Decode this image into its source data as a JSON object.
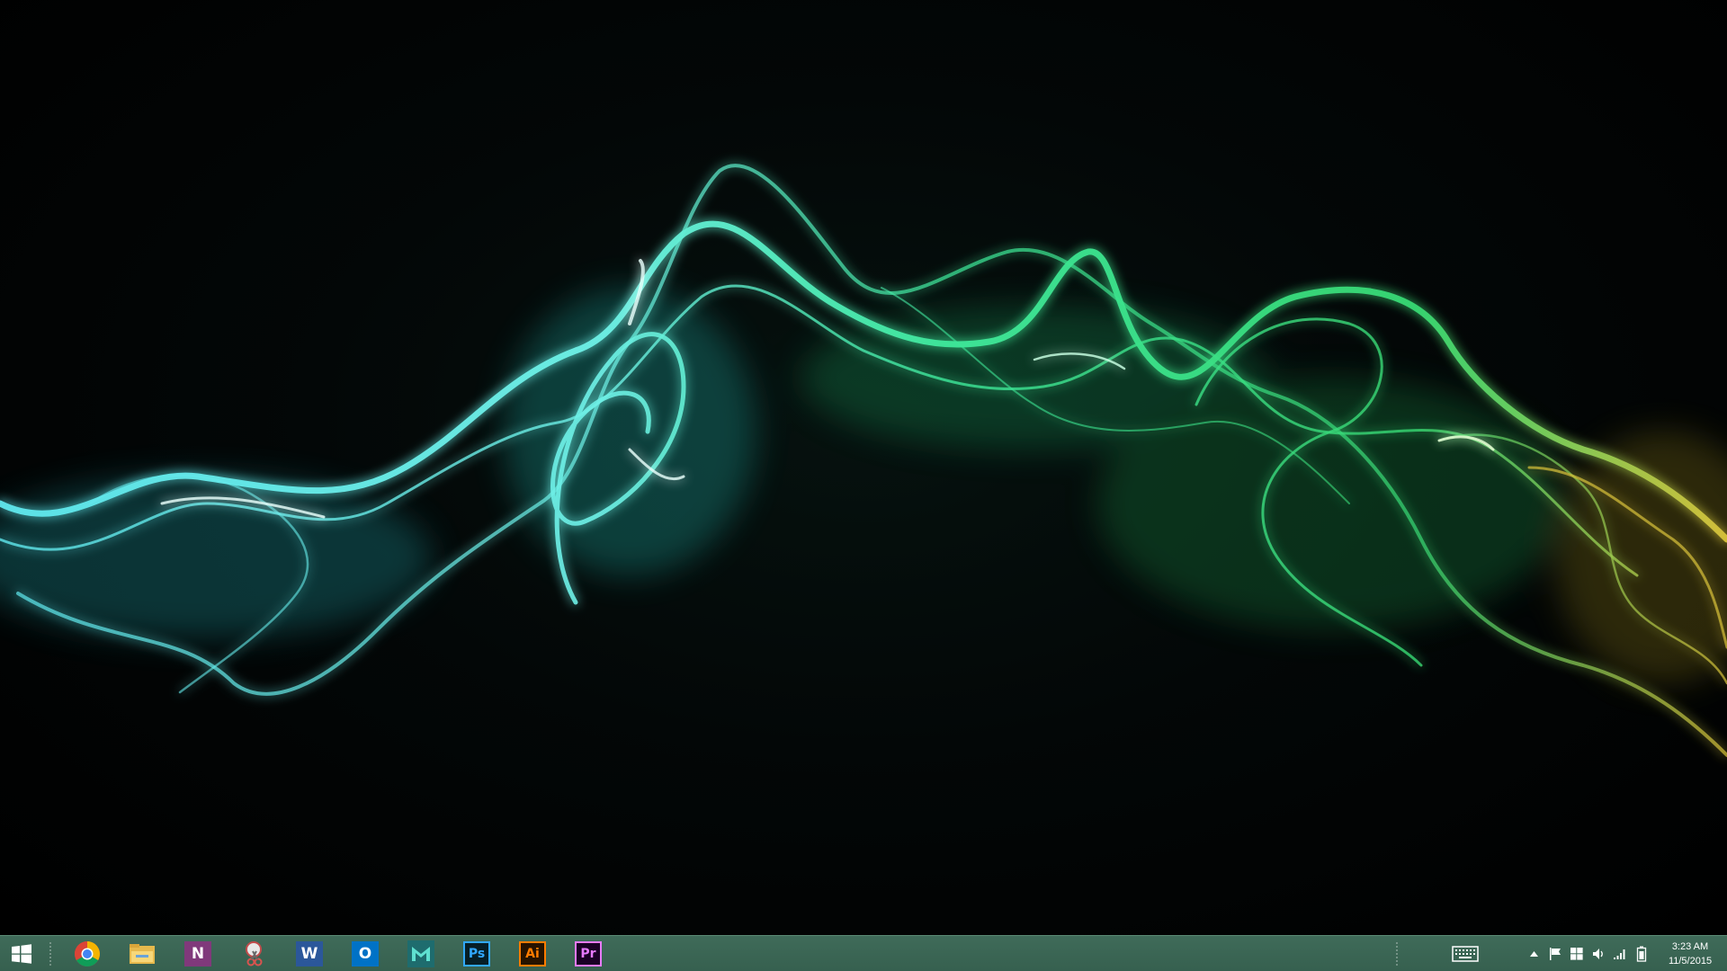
{
  "desktop": {
    "wallpaper": "abstract glowing smoke ribbon, cyan to green to yellow on black",
    "colors": {
      "cyan": "#5fe6ec",
      "green": "#3ee89a",
      "yellow": "#d8c23a"
    }
  },
  "taskbar": {
    "background": "#3b6653",
    "start": {
      "icon": "windows-logo-icon"
    },
    "pinned": [
      {
        "name": "Google Chrome",
        "icon": "chrome-icon"
      },
      {
        "name": "File Explorer",
        "icon": "folder-icon"
      },
      {
        "name": "OneNote",
        "icon": "onenote-icon",
        "glyph": "N"
      },
      {
        "name": "Snipping Tool",
        "icon": "scissors-icon"
      },
      {
        "name": "Word",
        "icon": "word-icon",
        "glyph": "W"
      },
      {
        "name": "Outlook",
        "icon": "outlook-icon",
        "glyph": "O"
      },
      {
        "name": "Autodesk Maya",
        "icon": "maya-icon"
      },
      {
        "name": "Photoshop",
        "icon": "photoshop-icon",
        "glyph": "Ps"
      },
      {
        "name": "Illustrator",
        "icon": "illustrator-icon",
        "glyph": "Ai"
      },
      {
        "name": "Premiere Pro",
        "icon": "premiere-icon",
        "glyph": "Pr"
      }
    ],
    "tray": {
      "keyboard": "touch-keyboard-icon",
      "show_hidden": "up-arrow-icon",
      "action_center": "flag-icon",
      "windows": "windows-small-icon",
      "volume": "speaker-icon",
      "network": "signal-bars-icon",
      "battery": "battery-icon"
    },
    "clock": {
      "time": "3:23 AM",
      "date": "11/5/2015"
    }
  }
}
